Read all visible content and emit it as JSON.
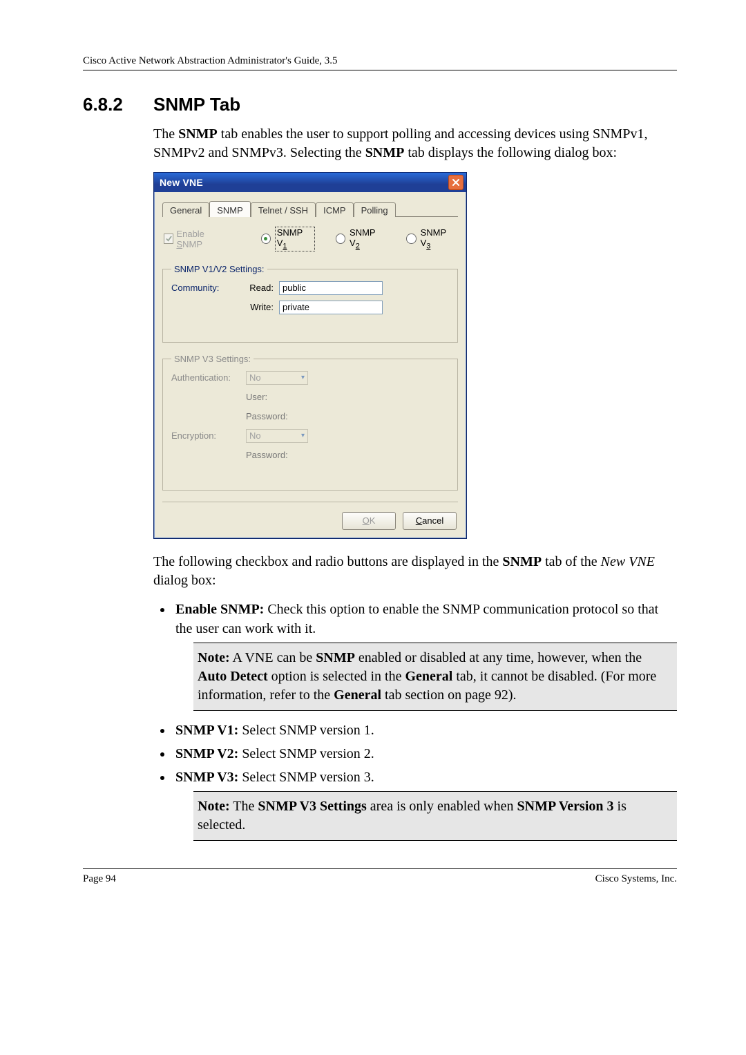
{
  "header": "Cisco Active Network Abstraction Administrator's Guide, 3.5",
  "section": {
    "number": "6.8.2",
    "title": "SNMP Tab"
  },
  "intro_p1_a": "The ",
  "intro_p1_b": "SNMP",
  "intro_p1_c": " tab enables the user to support polling and accessing devices using SNMPv1, SNMPv2 and SNMPv3. Selecting the ",
  "intro_p1_d": "SNMP",
  "intro_p1_e": " tab displays the following dialog box:",
  "dialog": {
    "title": "New VNE",
    "tabs": {
      "general": "General",
      "snmp": "SNMP",
      "telnet": "Telnet / SSH",
      "icmp": "ICMP",
      "polling": "Polling"
    },
    "enable_label": "Enable SNMP",
    "radios": {
      "v1_pre": "SNMP V",
      "v1_sub": "1",
      "v2_pre": "SNMP V",
      "v2_sub": "2",
      "v3_pre": "SNMP V",
      "v3_sub": "3"
    },
    "v1v2_legend": "SNMP V1/V2 Settings:",
    "community_label": "Community:",
    "read_label": "Read:",
    "write_label": "Write:",
    "read_value": "public",
    "write_value": "private",
    "v3_legend": "SNMP V3 Settings:",
    "auth_label": "Authentication:",
    "auth_sel": "No",
    "user_label": "User:",
    "password_label": "Password:",
    "encryption_label": "Encryption:",
    "encryption_sel": "No",
    "ok": "OK",
    "cancel": "Cancel"
  },
  "after_dialog_a": "The following checkbox and radio buttons are displayed in the ",
  "after_dialog_b": "SNMP",
  "after_dialog_c": " tab of the ",
  "after_dialog_d": "New VNE",
  "after_dialog_e": " dialog box:",
  "bullets": {
    "enable_t": "Enable SNMP:",
    "enable_r": " Check this option to enable the SNMP communication protocol so that the user can work with it.",
    "v1_t": "SNMP V1:",
    "v1_r": " Select SNMP version 1.",
    "v2_t": "SNMP V2:",
    "v2_r": " Select SNMP version 2.",
    "v3_t": "SNMP V3:",
    "v3_r": " Select SNMP version 3."
  },
  "note1_a": "Note:",
  "note1_b": " A VNE can be ",
  "note1_c": "SNMP",
  "note1_d": " enabled or disabled at any time, however, when the ",
  "note1_e": "Auto Detect",
  "note1_f": " option is selected in the ",
  "note1_g": "General",
  "note1_h": " tab, it cannot be disabled. (For more information, refer to the ",
  "note1_i": "General",
  "note1_j": " tab section on page 92).",
  "note2_a": "Note:",
  "note2_b": " The ",
  "note2_c": "SNMP V3 Settings",
  "note2_d": " area is only enabled when ",
  "note2_e": "SNMP Version 3",
  "note2_f": " is selected.",
  "footer": {
    "left": "Page 94",
    "right": "Cisco Systems, Inc."
  }
}
